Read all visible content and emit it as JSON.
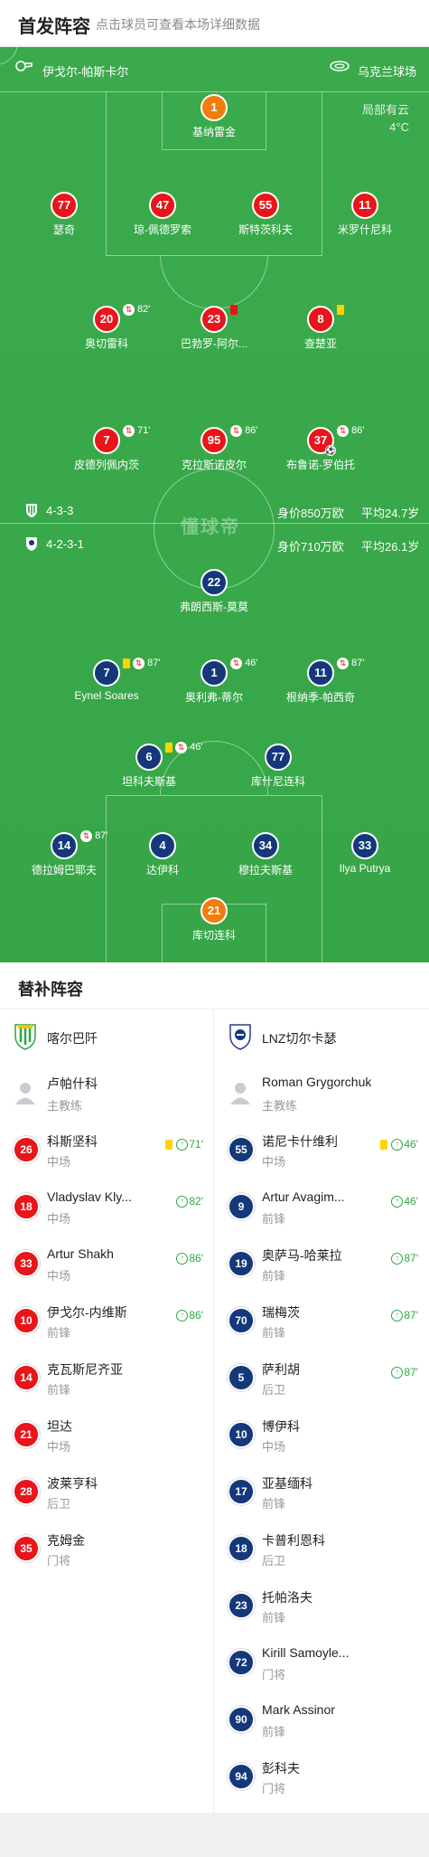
{
  "header": {
    "title": "首发阵容",
    "subtitle": "点击球员可查看本场详细数据"
  },
  "pitch": {
    "referee": "伊戈尔-帕斯卡尔",
    "stadium": "乌克兰球场",
    "weather_desc": "局部有云",
    "temperature": "4°C",
    "brand": "懂球帝",
    "home_formation": {
      "formation": "4-3-3",
      "value": "身价850万欧",
      "avg_age": "平均24.7岁"
    },
    "away_formation": {
      "formation": "4-2-3-1",
      "value": "身价710万欧",
      "avg_age": "平均26.1岁"
    }
  },
  "home_players": [
    {
      "num": "1",
      "name": "基纳雷金",
      "gk": true
    },
    {
      "num": "77",
      "name": "瑟奇"
    },
    {
      "num": "47",
      "name": "琼-佩德罗索"
    },
    {
      "num": "55",
      "name": "斯特茨科夫"
    },
    {
      "num": "11",
      "name": "米罗什尼科"
    },
    {
      "num": "20",
      "name": "奥切雷科",
      "sub_min": "82'"
    },
    {
      "num": "23",
      "name": "巴勃罗-阿尔...",
      "card": "red"
    },
    {
      "num": "8",
      "name": "查楚亚",
      "card": "yellow"
    },
    {
      "num": "7",
      "name": "皮德列佩内茨",
      "sub_min": "71'"
    },
    {
      "num": "95",
      "name": "克拉斯诺皮尔",
      "sub_min": "86'"
    },
    {
      "num": "37",
      "name": "布鲁诺-罗伯托",
      "sub_min": "86'",
      "goal": true
    }
  ],
  "away_players": [
    {
      "num": "22",
      "name": "弗朗西斯-莫莫",
      "gk": true
    },
    {
      "num": "7",
      "name": "Eynel Soares",
      "sub_min": "87'",
      "card": "yellow"
    },
    {
      "num": "1",
      "name": "奥利弗-蒂尔",
      "sub_min": "46'"
    },
    {
      "num": "11",
      "name": "根纳季-帕西奇",
      "sub_min": "87'"
    },
    {
      "num": "6",
      "name": "坦科夫斯基",
      "sub_min": "46'",
      "card": "yellow"
    },
    {
      "num": "77",
      "name": "库什尼连科"
    },
    {
      "num": "14",
      "name": "德拉姆巴耶夫",
      "sub_min": "87'"
    },
    {
      "num": "4",
      "name": "达伊科"
    },
    {
      "num": "34",
      "name": "穆拉夫斯基"
    },
    {
      "num": "33",
      "name": "Ilya Putrya"
    },
    {
      "num": "21",
      "name": "库切连科",
      "gk": true
    }
  ],
  "subs": {
    "title": "替补阵容",
    "home": {
      "team": "喀尔巴阡",
      "coach": {
        "name": "卢帕什科",
        "role": "主教练"
      },
      "players": [
        {
          "num": "26",
          "name": "科斯坚科",
          "pos": "中场",
          "card": "yellow",
          "on": "71'"
        },
        {
          "num": "18",
          "name": "Vladyslav Kly...",
          "pos": "中场",
          "on": "82'"
        },
        {
          "num": "33",
          "name": "Artur Shakh",
          "pos": "中场",
          "on": "86'"
        },
        {
          "num": "10",
          "name": "伊戈尔-内维斯",
          "pos": "前锋",
          "on": "86'"
        },
        {
          "num": "14",
          "name": "克瓦斯尼齐亚",
          "pos": "前锋"
        },
        {
          "num": "21",
          "name": "坦达",
          "pos": "中场"
        },
        {
          "num": "28",
          "name": "波莱亨科",
          "pos": "后卫"
        },
        {
          "num": "35",
          "name": "克姆金",
          "pos": "门将"
        }
      ]
    },
    "away": {
      "team": "LNZ切尔卡瑟",
      "coach": {
        "name": "Roman Grygorchuk",
        "role": "主教练"
      },
      "players": [
        {
          "num": "55",
          "name": "诺尼卡什维利",
          "pos": "中场",
          "card": "yellow",
          "on": "46'"
        },
        {
          "num": "9",
          "name": "Artur Avagim...",
          "pos": "前锋",
          "on": "46'"
        },
        {
          "num": "19",
          "name": "奥萨马-哈莱拉",
          "pos": "前锋",
          "on": "87'"
        },
        {
          "num": "70",
          "name": "瑞梅茨",
          "pos": "前锋",
          "on": "87'"
        },
        {
          "num": "5",
          "name": "萨利胡",
          "pos": "后卫",
          "on": "87'"
        },
        {
          "num": "10",
          "name": "博伊科",
          "pos": "中场"
        },
        {
          "num": "17",
          "name": "亚基缅科",
          "pos": "前锋"
        },
        {
          "num": "18",
          "name": "卡普利恩科",
          "pos": "后卫"
        },
        {
          "num": "23",
          "name": "托帕洛夫",
          "pos": "前锋"
        },
        {
          "num": "72",
          "name": "Kirill Samoyle...",
          "pos": "门将"
        },
        {
          "num": "90",
          "name": "Mark Assinor",
          "pos": "前锋"
        },
        {
          "num": "94",
          "name": "彭科夫",
          "pos": "门将"
        }
      ]
    }
  },
  "colors": {
    "home": "#e8151b",
    "away": "#14387a",
    "keeper": "#f07d0e",
    "pitch": "#3aaa4c"
  }
}
